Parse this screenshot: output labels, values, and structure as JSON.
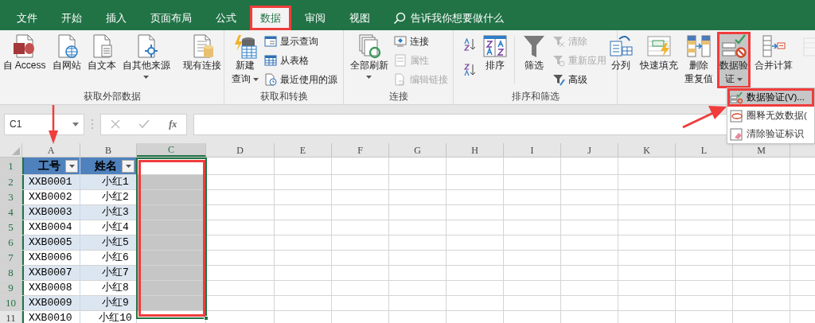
{
  "tabs": [
    {
      "label": "文件",
      "selected": false,
      "highlighted": false
    },
    {
      "label": "开始",
      "selected": false,
      "highlighted": false
    },
    {
      "label": "插入",
      "selected": false,
      "highlighted": false
    },
    {
      "label": "页面布局",
      "selected": false,
      "highlighted": false
    },
    {
      "label": "公式",
      "selected": false,
      "highlighted": false
    },
    {
      "label": "数据",
      "selected": true,
      "highlighted": true
    },
    {
      "label": "审阅",
      "selected": false,
      "highlighted": false
    },
    {
      "label": "视图",
      "selected": false,
      "highlighted": false
    }
  ],
  "search": {
    "placeholder": "告诉我你想要做什么"
  },
  "ribbon": {
    "groups": [
      {
        "label": "获取外部数据",
        "items": [
          {
            "kind": "large",
            "label": "自 Access"
          },
          {
            "kind": "large",
            "label": "自网站"
          },
          {
            "kind": "large",
            "label": "自文本"
          },
          {
            "kind": "large",
            "label": "自其他来源",
            "dropdown": true
          },
          {
            "kind": "divider"
          },
          {
            "kind": "large",
            "label": "现有连接"
          }
        ]
      },
      {
        "label": "获取和转换",
        "items": [
          {
            "kind": "large",
            "label_lines": [
              "新建",
              "查询"
            ],
            "dropdown": true
          },
          {
            "kind": "small",
            "label": "显示查询",
            "disabled": false
          },
          {
            "kind": "small",
            "label": "从表格",
            "disabled": false
          },
          {
            "kind": "small",
            "label": "最近使用的源",
            "disabled": false
          }
        ]
      },
      {
        "label": "连接",
        "items": [
          {
            "kind": "large",
            "label": "全部刷新",
            "dropdown": true
          },
          {
            "kind": "small",
            "label": "连接",
            "disabled": false
          },
          {
            "kind": "small",
            "label": "属性",
            "disabled": true
          },
          {
            "kind": "small",
            "label": "编辑链接",
            "disabled": true
          }
        ]
      },
      {
        "label": "排序和筛选",
        "items": [
          {
            "kind": "icon"
          },
          {
            "kind": "icon"
          },
          {
            "kind": "large",
            "label": "排序"
          },
          {
            "kind": "divider"
          },
          {
            "kind": "large",
            "label": "筛选"
          },
          {
            "kind": "small",
            "label": "清除",
            "disabled": true
          },
          {
            "kind": "small",
            "label": "重新应用",
            "disabled": true
          },
          {
            "kind": "small",
            "label": "高级",
            "disabled": false
          }
        ]
      },
      {
        "items": [
          {
            "kind": "large",
            "label": "分列"
          },
          {
            "kind": "large",
            "label": "快速填充"
          },
          {
            "kind": "large",
            "label_lines": [
              "删除",
              "重复值"
            ]
          },
          {
            "kind": "large",
            "label_lines": [
              "数据验",
              "证"
            ],
            "dropdown": true,
            "pressed": true,
            "highlighted": true
          },
          {
            "kind": "large",
            "label": "合并计算"
          },
          {
            "kind": "large",
            "disabled": true
          }
        ]
      }
    ]
  },
  "menu": {
    "items": [
      {
        "label": "数据验证(V)...",
        "highlighted": true
      },
      {
        "label": "圈释无效数据(",
        "highlighted": false
      },
      {
        "label": "清除验证标识",
        "highlighted": false
      }
    ]
  },
  "formula_bar": {
    "name_box": "C1",
    "fx_label": "fx"
  },
  "sheet": {
    "columns": [
      {
        "label": "A",
        "selected": false
      },
      {
        "label": "B",
        "selected": false
      },
      {
        "label": "C",
        "selected": true
      },
      {
        "label": "D",
        "selected": false
      },
      {
        "label": "E",
        "selected": false
      },
      {
        "label": "F",
        "selected": false
      },
      {
        "label": "G",
        "selected": false
      },
      {
        "label": "H",
        "selected": false
      },
      {
        "label": "I",
        "selected": false
      },
      {
        "label": "J",
        "selected": false
      },
      {
        "label": "K",
        "selected": false
      },
      {
        "label": "L",
        "selected": false
      },
      {
        "label": "M",
        "selected": false
      }
    ],
    "selection_highlighted": true,
    "rows": [
      {
        "number": "1",
        "selected": true,
        "active": true,
        "kind": "header",
        "cells": [
          "工号",
          "姓名"
        ]
      },
      {
        "number": "2",
        "selected": true,
        "active": false,
        "kind": "data",
        "shaded": true,
        "cells": [
          "XXB0001",
          "小红1"
        ]
      },
      {
        "number": "3",
        "selected": true,
        "active": false,
        "kind": "data",
        "shaded": false,
        "cells": [
          "XXB0002",
          "小红2"
        ]
      },
      {
        "number": "4",
        "selected": true,
        "active": false,
        "kind": "data",
        "shaded": true,
        "cells": [
          "XXB0003",
          "小红3"
        ]
      },
      {
        "number": "5",
        "selected": true,
        "active": false,
        "kind": "data",
        "shaded": false,
        "cells": [
          "XXB0004",
          "小红4"
        ]
      },
      {
        "number": "6",
        "selected": true,
        "active": false,
        "kind": "data",
        "shaded": true,
        "cells": [
          "XXB0005",
          "小红5"
        ]
      },
      {
        "number": "7",
        "selected": true,
        "active": false,
        "kind": "data",
        "shaded": false,
        "cells": [
          "XXB0006",
          "小红6"
        ]
      },
      {
        "number": "8",
        "selected": true,
        "active": false,
        "kind": "data",
        "shaded": true,
        "cells": [
          "XXB0007",
          "小红7"
        ]
      },
      {
        "number": "9",
        "selected": true,
        "active": false,
        "kind": "data",
        "shaded": false,
        "cells": [
          "XXB0008",
          "小红8"
        ]
      },
      {
        "number": "10",
        "selected": true,
        "active": false,
        "kind": "data",
        "shaded": true,
        "cells": [
          "XXB0009",
          "小红9"
        ]
      },
      {
        "number": "11",
        "selected": false,
        "kind": "data",
        "shaded": false,
        "cells": [
          "XXB0010",
          "小红10"
        ]
      }
    ]
  },
  "pointer_arrows": {
    "to_column": true,
    "to_menu": true
  }
}
